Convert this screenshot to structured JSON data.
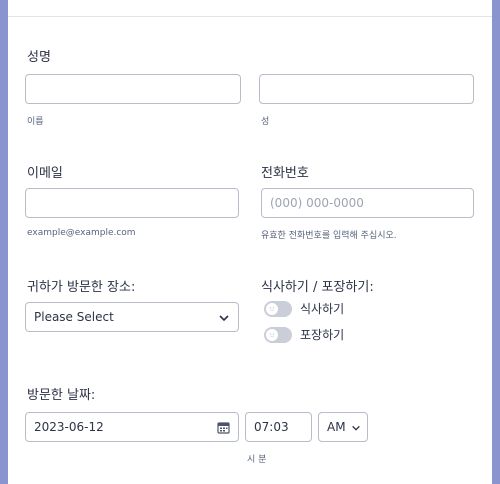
{
  "form": {
    "name": {
      "label": "성명",
      "first_sublabel": "이름",
      "last_sublabel": "성",
      "first_value": "",
      "last_value": ""
    },
    "email": {
      "label": "이메일",
      "value": "",
      "sublabel": "example@example.com"
    },
    "phone": {
      "label": "전화번호",
      "placeholder": "(000) 000-0000",
      "sublabel": "유효한 전화번호를 입력해 주십시오."
    },
    "place": {
      "label": "귀하가 방문한 장소:",
      "selected": "Please Select"
    },
    "dining": {
      "label": "식사하기 / 포장하기:",
      "options": [
        {
          "label": "식사하기",
          "on": false
        },
        {
          "label": "포장하기",
          "on": false
        }
      ]
    },
    "visit_date": {
      "label": "방문한 날짜:",
      "date": "2023-06-12",
      "time": "07:03",
      "ampm": "AM",
      "time_sublabel": "시 분"
    }
  },
  "icons": {
    "calendar": "calendar-icon",
    "chevron": "chevron-down-icon",
    "toggle_face": "face-icon"
  }
}
